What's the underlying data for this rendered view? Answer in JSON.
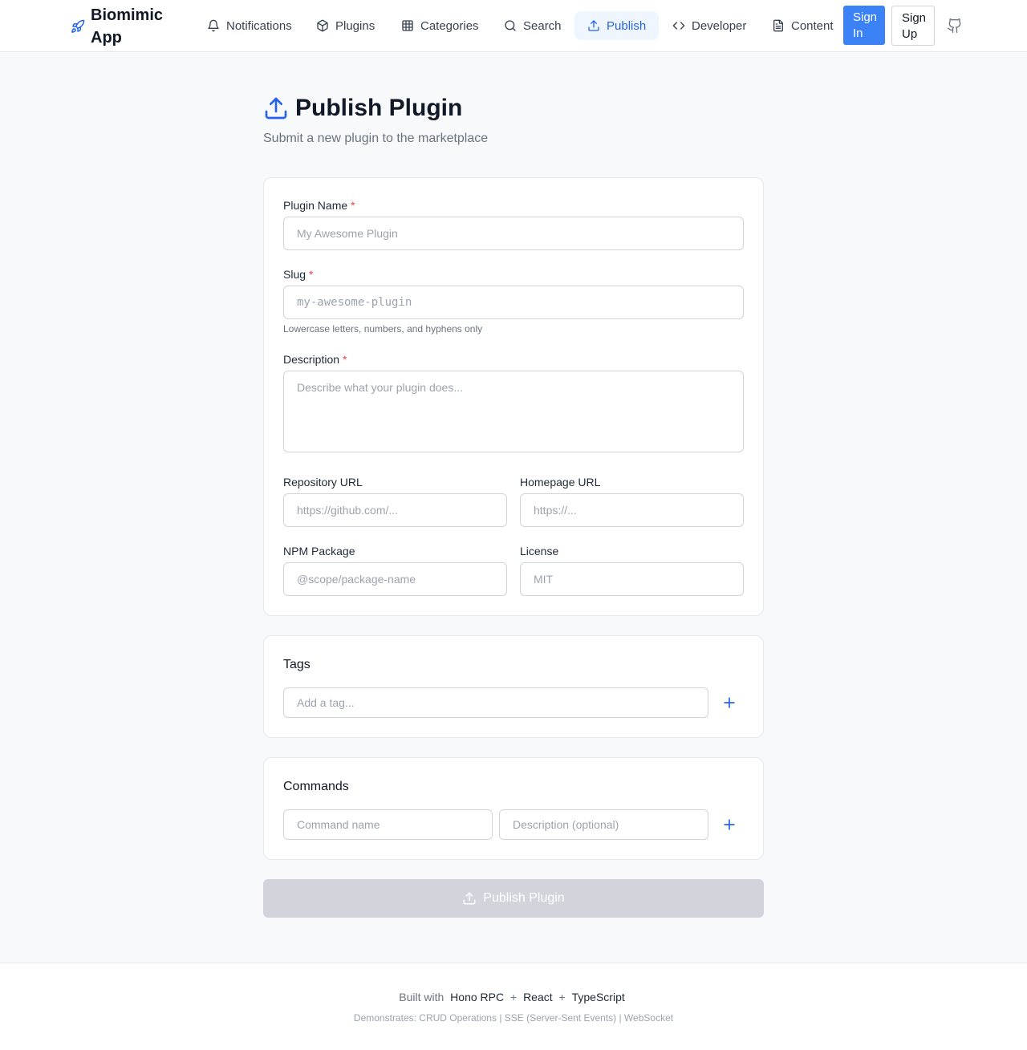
{
  "header": {
    "brand": "Biomimic App",
    "nav": [
      {
        "label": "Notifications",
        "icon": "bell-icon"
      },
      {
        "label": "Plugins",
        "icon": "package-icon"
      },
      {
        "label": "Categories",
        "icon": "grid-icon"
      },
      {
        "label": "Search",
        "icon": "search-icon"
      },
      {
        "label": "Publish",
        "icon": "upload-icon",
        "active": true
      },
      {
        "label": "Developer",
        "icon": "code-icon"
      },
      {
        "label": "Content",
        "icon": "file-text-icon"
      }
    ],
    "sign_in": "Sign In",
    "sign_up": "Sign Up",
    "accent": "#3b82f6"
  },
  "page": {
    "title": "Publish Plugin",
    "subtitle": "Submit a new plugin to the marketplace"
  },
  "form": {
    "plugin_name": {
      "label": "Plugin Name",
      "required": "*",
      "placeholder": "My Awesome Plugin"
    },
    "slug": {
      "label": "Slug",
      "required": "*",
      "placeholder": "my-awesome-plugin",
      "hint": "Lowercase letters, numbers, and hyphens only"
    },
    "description": {
      "label": "Description",
      "required": "*",
      "placeholder": "Describe what your plugin does..."
    },
    "repository_url": {
      "label": "Repository URL",
      "placeholder": "https://github.com/..."
    },
    "homepage_url": {
      "label": "Homepage URL",
      "placeholder": "https://..."
    },
    "npm_package": {
      "label": "NPM Package",
      "placeholder": "@scope/package-name"
    },
    "license": {
      "label": "License",
      "placeholder": "MIT"
    }
  },
  "tags": {
    "title": "Tags",
    "placeholder": "Add a tag..."
  },
  "commands": {
    "title": "Commands",
    "name_placeholder": "Command name",
    "desc_placeholder": "Description (optional)"
  },
  "publish_button": "Publish Plugin",
  "footer": {
    "built_with": "Built with",
    "tech": [
      "Hono RPC",
      "React",
      "TypeScript"
    ],
    "separator": "+",
    "demonstrates": "Demonstrates: CRUD Operations | SSE (Server-Sent Events) | WebSocket"
  }
}
